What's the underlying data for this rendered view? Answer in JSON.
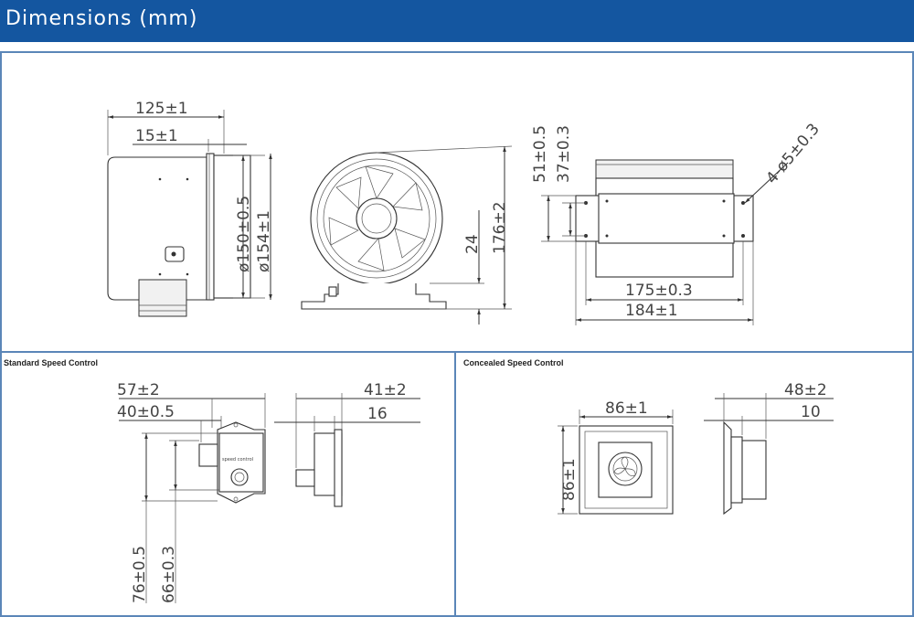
{
  "header": {
    "title": "Dimensions  (mm)"
  },
  "panels": {
    "standard": {
      "label": "Standard Speed Control"
    },
    "concealed": {
      "label": "Concealed Speed Control"
    }
  },
  "fan": {
    "side": {
      "length": "125±1",
      "flange": "15±1",
      "inner_dia": "ø150±0.5",
      "outer_dia": "ø154±1"
    },
    "front": {
      "base": "24",
      "height": "176±2"
    },
    "top": {
      "h1": "51±0.5",
      "h2": "37±0.3",
      "holes": "4-ø5±0.3",
      "inner_width": "175±0.3",
      "outer_width": "184±1"
    }
  },
  "standard_control": {
    "width": "57±2",
    "inner": "40±0.5",
    "height_total": "76±0.5",
    "height_inner": "66±0.3",
    "depth": "41±2",
    "depth_inner": "16",
    "face_text": "speed control"
  },
  "concealed_control": {
    "width": "86±1",
    "height": "86±1",
    "depth": "48±2",
    "depth_inner": "10"
  },
  "colors": {
    "header": "#1456a0",
    "frame": "#5b86b8"
  }
}
